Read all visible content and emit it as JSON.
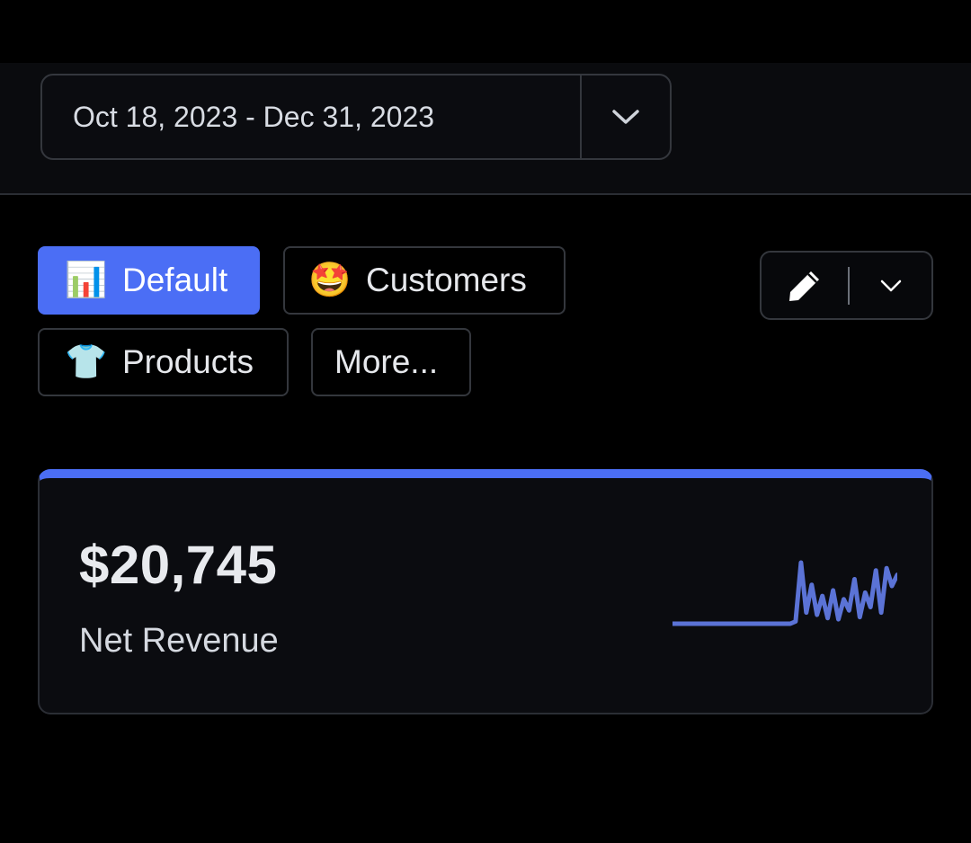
{
  "date_range": {
    "label": "Oct 18, 2023 - Dec 31, 2023",
    "toggle_icon": "chevron-down-icon"
  },
  "tabs": [
    {
      "label": "Default",
      "emoji": "📊",
      "active": true
    },
    {
      "label": "Customers",
      "emoji": "🤩",
      "active": false
    },
    {
      "label": "Products",
      "emoji": "👕",
      "active": false
    },
    {
      "label": "More...",
      "emoji": "",
      "active": false
    }
  ],
  "edit_group": {
    "edit_icon": "pencil-icon",
    "menu_icon": "chevron-down-icon"
  },
  "card": {
    "value": "$20,745",
    "label": "Net Revenue",
    "accent_color": "#4b6ef5",
    "sparkline_values": [
      0,
      0,
      0,
      0,
      0,
      0,
      0,
      0,
      0,
      0,
      0,
      0,
      0,
      0,
      0,
      0,
      0,
      0,
      0,
      0,
      0,
      0,
      0,
      2,
      55,
      10,
      35,
      8,
      25,
      5,
      30,
      4,
      22,
      12,
      40,
      6,
      28,
      15,
      48,
      10,
      50,
      34,
      44
    ]
  },
  "colors": {
    "background": "#000000",
    "accent": "#4b6ef5",
    "border": "#34373d",
    "sparkline": "#5b73d6"
  }
}
